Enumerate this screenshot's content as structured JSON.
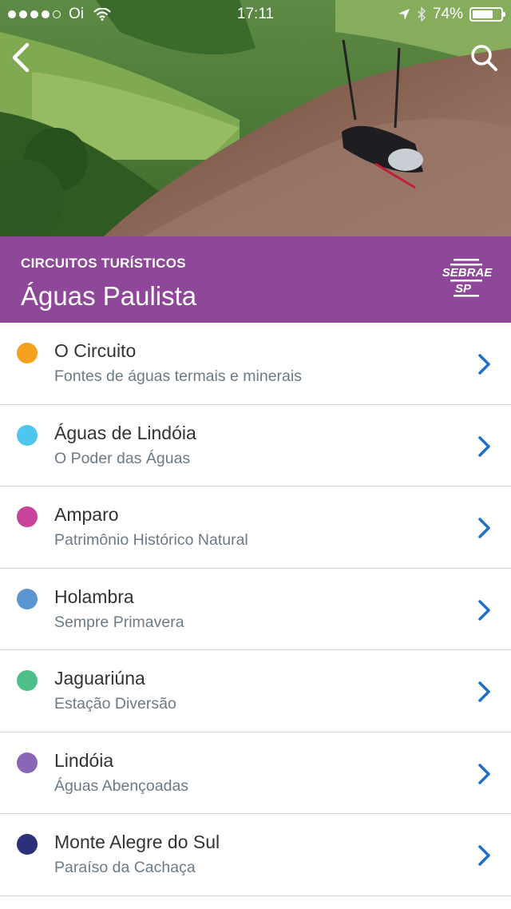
{
  "status_bar": {
    "carrier": "Oi",
    "time": "17:11",
    "battery_percent_label": "74%",
    "battery_level": 0.74,
    "signal_bars_filled": 4,
    "signal_bars_total": 5
  },
  "banner": {
    "kicker": "CIRCUITOS TURÍSTICOS",
    "title": "Águas Paulista",
    "logo_text": "SEBRAE SP"
  },
  "colors": {
    "banner_bg": "#8f4799",
    "chevron": "#1e6fc8"
  },
  "icons": [
    "back-arrow-icon",
    "search-icon",
    "chevron-right-icon",
    "wifi-icon",
    "location-arrow-icon",
    "bluetooth-icon",
    "battery-icon"
  ],
  "circuits": [
    {
      "title": "O Circuito",
      "subtitle": "Fontes de águas termais e minerais",
      "color": "#f4a11d"
    },
    {
      "title": "Águas de Lindóia",
      "subtitle": "O Poder das Águas",
      "color": "#4ec6f0"
    },
    {
      "title": "Amparo",
      "subtitle": "Patrimônio Histórico Natural",
      "color": "#c6449b"
    },
    {
      "title": "Holambra",
      "subtitle": "Sempre Primavera",
      "color": "#5b95d2"
    },
    {
      "title": "Jaguariúna",
      "subtitle": "Estação Diversão",
      "color": "#4fbf8a"
    },
    {
      "title": "Lindóia",
      "subtitle": "Águas Abençoadas",
      "color": "#8a66b8"
    },
    {
      "title": "Monte Alegre do Sul",
      "subtitle": "Paraíso da Cachaça",
      "color": "#2c2f7a"
    }
  ]
}
